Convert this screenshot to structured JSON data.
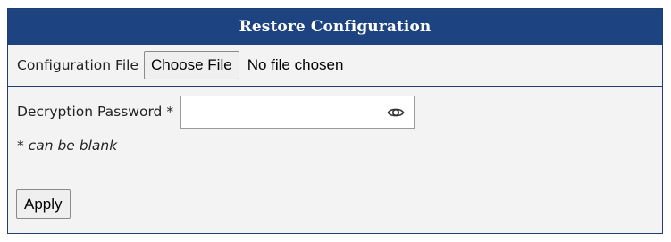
{
  "panel": {
    "title": "Restore Configuration"
  },
  "config_file": {
    "label": "Configuration File",
    "button_label": "Choose File",
    "status": "No file chosen"
  },
  "decryption": {
    "label": "Decryption Password *",
    "value": "",
    "note": "* can be blank",
    "toggle_icon": "eye-icon"
  },
  "actions": {
    "apply_label": "Apply"
  },
  "colors": {
    "header_bg": "#1d4480",
    "header_text": "#ffffff",
    "border": "#1f3f72",
    "panel_bg": "#f3f3f3"
  }
}
